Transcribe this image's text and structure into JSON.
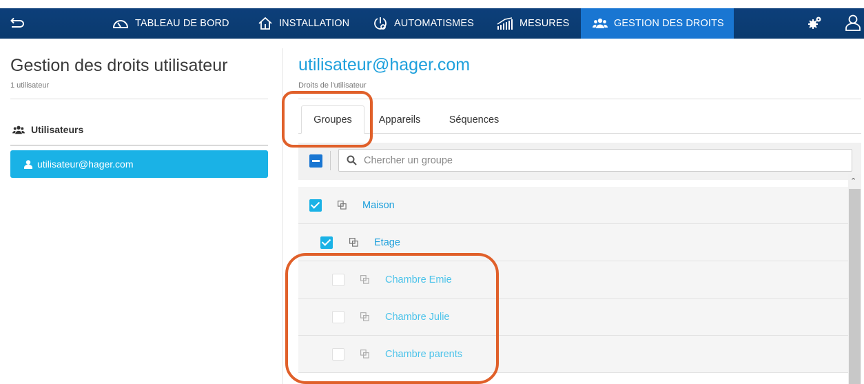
{
  "nav": {
    "items": [
      {
        "label": "TABLEAU DE BORD",
        "icon": "dashboard-gauge-icon"
      },
      {
        "label": "INSTALLATION",
        "icon": "house-icon"
      },
      {
        "label": "AUTOMATISMES",
        "icon": "automation-icon"
      },
      {
        "label": "MESURES",
        "icon": "bar-chart-icon"
      },
      {
        "label": "GESTION DES DROITS",
        "icon": "users-group-icon",
        "active": true
      }
    ],
    "active_color": "#1976d2",
    "bar_color": "#0d3f7a"
  },
  "left_panel": {
    "title": "Gestion des droits utilisateur",
    "subtitle": "1 utilisateur",
    "users_heading": "Utilisateurs",
    "users": [
      {
        "label": "utilisateur@hager.com",
        "selected": true
      }
    ]
  },
  "right_panel": {
    "title": "utilisateur@hager.com",
    "subtitle": "Droits de l'utilisateur",
    "tabs": [
      {
        "label": "Groupes",
        "active": true
      },
      {
        "label": "Appareils",
        "active": false
      },
      {
        "label": "Séquences",
        "active": false
      }
    ],
    "search": {
      "placeholder": "Chercher un groupe",
      "value": ""
    },
    "groups": [
      {
        "label": "Maison",
        "checked": true,
        "level": 0
      },
      {
        "label": "Etage",
        "checked": true,
        "level": 1
      },
      {
        "label": "Chambre Emie",
        "checked": false,
        "level": 2
      },
      {
        "label": "Chambre Julie",
        "checked": false,
        "level": 2
      },
      {
        "label": "Chambre parents",
        "checked": false,
        "level": 2
      }
    ]
  },
  "accent_color": "#1ea0dc",
  "highlight_color": "#e0602a"
}
